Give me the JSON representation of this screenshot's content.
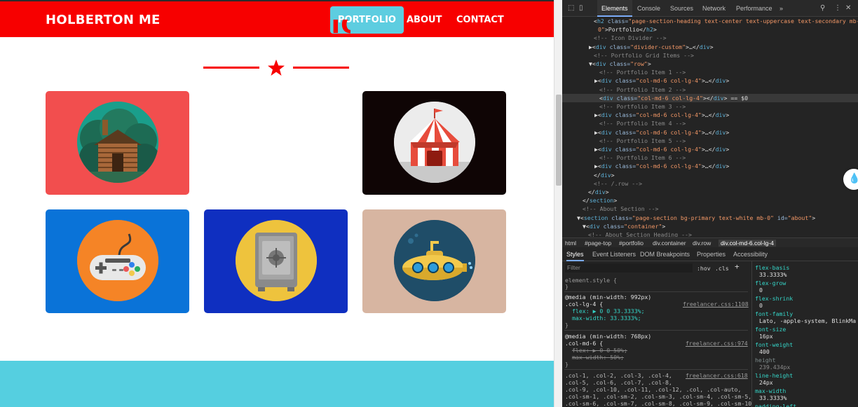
{
  "site": {
    "brand": "HOLBERTON ME",
    "nav": [
      {
        "label": "PORTFOLIO",
        "active": true
      },
      {
        "label": "ABOUT",
        "active": false
      },
      {
        "label": "CONTACT",
        "active": false
      }
    ],
    "section_heading": "PORTFOLIO",
    "portfolio_items": [
      {
        "name": "cabin",
        "bg": "#f24e4e"
      },
      {
        "name": "circus-tent",
        "bg": "#0f0505"
      },
      {
        "name": "game-controller",
        "bg": "#0a73d8"
      },
      {
        "name": "safe",
        "bg": "#0f2fc0"
      },
      {
        "name": "submarine",
        "bg": "#d7b5a1"
      }
    ],
    "colors": {
      "primary": "#f70000",
      "accent": "#55cfe0"
    }
  },
  "devtools": {
    "tabs": [
      "Elements",
      "Console",
      "Sources",
      "Network",
      "Performance",
      "»"
    ],
    "active_tab": "Elements",
    "dom_lines": [
      [
        {
          "c": "c-txt",
          "t": "<"
        },
        {
          "c": "c-tag",
          "t": "h2"
        },
        {
          "c": "c-attr",
          "t": " class="
        },
        {
          "c": "c-val",
          "t": "\"page-section-heading text-center text-uppercase text-secondary mb-"
        }
      ],
      [
        {
          "c": "c-val",
          "t": "0\""
        },
        {
          "c": "c-txt",
          "t": ">Portfolio</"
        },
        {
          "c": "c-tag",
          "t": "h2"
        },
        {
          "c": "c-txt",
          "t": ">"
        }
      ],
      [
        {
          "c": "c-com",
          "t": "<!-- Icon Divider -->"
        }
      ],
      [
        {
          "c": "c-txt",
          "t": "▶<"
        },
        {
          "c": "c-tag",
          "t": "div"
        },
        {
          "c": "c-attr",
          "t": " class="
        },
        {
          "c": "c-val",
          "t": "\"divider-custom\""
        },
        {
          "c": "c-txt",
          "t": ">…</"
        },
        {
          "c": "c-tag",
          "t": "div"
        },
        {
          "c": "c-txt",
          "t": ">"
        }
      ],
      [
        {
          "c": "c-com",
          "t": "<!-- Portfolio Grid Items -->"
        }
      ],
      [
        {
          "c": "c-txt",
          "t": "▼<"
        },
        {
          "c": "c-tag",
          "t": "div"
        },
        {
          "c": "c-attr",
          "t": " class="
        },
        {
          "c": "c-val",
          "t": "\"row\""
        },
        {
          "c": "c-txt",
          "t": ">"
        }
      ],
      [
        {
          "c": "c-com",
          "t": "<!-- Portfolio Item 1 -->"
        }
      ],
      [
        {
          "c": "c-txt",
          "t": "▶<"
        },
        {
          "c": "c-tag",
          "t": "div"
        },
        {
          "c": "c-attr",
          "t": " class="
        },
        {
          "c": "c-val",
          "t": "\"col-md-6 col-lg-4\""
        },
        {
          "c": "c-txt",
          "t": ">…</"
        },
        {
          "c": "c-tag",
          "t": "div"
        },
        {
          "c": "c-txt",
          "t": ">"
        }
      ],
      [
        {
          "c": "c-com",
          "t": "<!-- Portfolio Item 2 -->"
        }
      ],
      [
        {
          "c": "c-txt",
          "t": "<"
        },
        {
          "c": "c-tag",
          "t": "div"
        },
        {
          "c": "c-attr",
          "t": " class="
        },
        {
          "c": "c-val",
          "t": "\"col-md-6 col-lg-4\""
        },
        {
          "c": "c-txt",
          "t": "></"
        },
        {
          "c": "c-tag",
          "t": "div"
        },
        {
          "c": "c-txt",
          "t": "> == $0"
        }
      ],
      [
        {
          "c": "c-com",
          "t": "<!-- Portfolio Item 3 -->"
        }
      ],
      [
        {
          "c": "c-txt",
          "t": "▶<"
        },
        {
          "c": "c-tag",
          "t": "div"
        },
        {
          "c": "c-attr",
          "t": " class="
        },
        {
          "c": "c-val",
          "t": "\"col-md-6 col-lg-4\""
        },
        {
          "c": "c-txt",
          "t": ">…</"
        },
        {
          "c": "c-tag",
          "t": "div"
        },
        {
          "c": "c-txt",
          "t": ">"
        }
      ],
      [
        {
          "c": "c-com",
          "t": "<!-- Portfolio Item 4 -->"
        }
      ],
      [
        {
          "c": "c-txt",
          "t": "▶<"
        },
        {
          "c": "c-tag",
          "t": "div"
        },
        {
          "c": "c-attr",
          "t": " class="
        },
        {
          "c": "c-val",
          "t": "\"col-md-6 col-lg-4\""
        },
        {
          "c": "c-txt",
          "t": ">…</"
        },
        {
          "c": "c-tag",
          "t": "div"
        },
        {
          "c": "c-txt",
          "t": ">"
        }
      ],
      [
        {
          "c": "c-com",
          "t": "<!-- Portfolio Item 5 -->"
        }
      ],
      [
        {
          "c": "c-txt",
          "t": "▶<"
        },
        {
          "c": "c-tag",
          "t": "div"
        },
        {
          "c": "c-attr",
          "t": " class="
        },
        {
          "c": "c-val",
          "t": "\"col-md-6 col-lg-4\""
        },
        {
          "c": "c-txt",
          "t": ">…</"
        },
        {
          "c": "c-tag",
          "t": "div"
        },
        {
          "c": "c-txt",
          "t": ">"
        }
      ],
      [
        {
          "c": "c-com",
          "t": "<!-- Portfolio Item 6 -->"
        }
      ],
      [
        {
          "c": "c-txt",
          "t": "▶<"
        },
        {
          "c": "c-tag",
          "t": "div"
        },
        {
          "c": "c-attr",
          "t": " class="
        },
        {
          "c": "c-val",
          "t": "\"col-md-6 col-lg-4\""
        },
        {
          "c": "c-txt",
          "t": ">…</"
        },
        {
          "c": "c-tag",
          "t": "div"
        },
        {
          "c": "c-txt",
          "t": ">"
        }
      ],
      [
        {
          "c": "c-txt",
          "t": "</"
        },
        {
          "c": "c-tag",
          "t": "div"
        },
        {
          "c": "c-txt",
          "t": ">"
        }
      ],
      [
        {
          "c": "c-com",
          "t": "<!-- /.row -->"
        }
      ],
      [
        {
          "c": "c-txt",
          "t": "</"
        },
        {
          "c": "c-tag",
          "t": "div"
        },
        {
          "c": "c-txt",
          "t": ">"
        }
      ],
      [
        {
          "c": "c-txt",
          "t": "</"
        },
        {
          "c": "c-tag",
          "t": "section"
        },
        {
          "c": "c-txt",
          "t": ">"
        }
      ],
      [
        {
          "c": "c-com",
          "t": "<!-- About Section -->"
        }
      ],
      [
        {
          "c": "c-txt",
          "t": "▼<"
        },
        {
          "c": "c-tag",
          "t": "section"
        },
        {
          "c": "c-attr",
          "t": " class="
        },
        {
          "c": "c-val",
          "t": "\"page-section bg-primary text-white mb-0\""
        },
        {
          "c": "c-attr",
          "t": " id="
        },
        {
          "c": "c-val",
          "t": "\"about\""
        },
        {
          "c": "c-txt",
          "t": ">"
        }
      ],
      [
        {
          "c": "c-txt",
          "t": "▼<"
        },
        {
          "c": "c-tag",
          "t": "div"
        },
        {
          "c": "c-attr",
          "t": " class="
        },
        {
          "c": "c-val",
          "t": "\"container\""
        },
        {
          "c": "c-txt",
          "t": ">"
        }
      ],
      [
        {
          "c": "c-com",
          "t": "<!-- About Section Heading -->"
        }
      ]
    ],
    "breadcrumbs": [
      "html",
      "#page-top",
      "#portfolio",
      "div.container",
      "div.row",
      "div.col-md-6.col-lg-4"
    ],
    "subtabs": [
      "Styles",
      "Event Listeners",
      "DOM Breakpoints",
      "Properties",
      "Accessibility"
    ],
    "filter_placeholder": "Filter",
    "filter_toggles": [
      ":hov",
      ".cls",
      "+"
    ],
    "style_rules": {
      "element_style": "element.style {",
      "close": "}",
      "media1": "@media (min-width: 992px)",
      "sel1": ".col-lg-4 {",
      "src1": "freelancer.css:1108",
      "r1_flex": "flex: ▶ 0 0 33.3333%;",
      "r1_maxw": "max-width: 33.3333%;",
      "media2": "@media (min-width: 768px)",
      "sel2": ".col-md-6 {",
      "src2": "freelancer.css:974",
      "r2_flex": "flex: ▶ 0 0 50%;",
      "r2_maxw": "max-width: 50%;",
      "grid1": ".col-1, .col-2, .col-3, .col-4,",
      "src3": "freelancer.css:618",
      "grid2": ".col-5, .col-6, .col-7, .col-8,",
      "grid3": ".col-9, .col-10, .col-11, .col-12, .col, .col-auto,",
      "grid4": ".col-sm-1, .col-sm-2, .col-sm-3, .col-sm-4, .col-sm-5,",
      "grid5": ".col-sm-6, .col-sm-7, .col-sm-8, .col-sm-9, .col-sm-10,"
    },
    "computed": [
      {
        "prop": "flex-basis",
        "val": "33.3333%"
      },
      {
        "prop": "flex-grow",
        "val": "0"
      },
      {
        "prop": "flex-shrink",
        "val": "0"
      },
      {
        "prop": "font-family",
        "val": "Lato, -apple-system, BlinkMa"
      },
      {
        "prop": "font-size",
        "val": "16px"
      },
      {
        "prop": "font-weight",
        "val": "400"
      },
      {
        "prop": "height",
        "val": "239.434px"
      },
      {
        "prop": "line-height",
        "val": "24px"
      },
      {
        "prop": "max-width",
        "val": "33.3333%"
      },
      {
        "prop": "padding-left",
        "val": ""
      }
    ]
  }
}
